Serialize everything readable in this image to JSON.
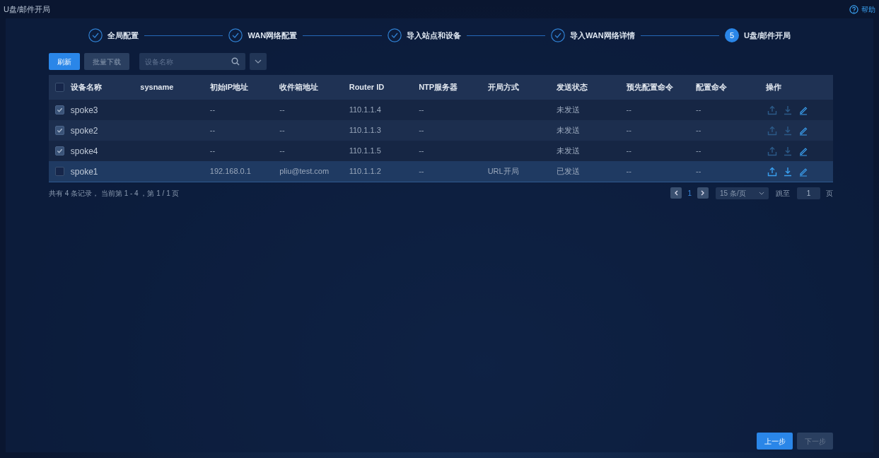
{
  "window": {
    "title": "U盘/邮件开局",
    "help": "帮助"
  },
  "steps": [
    {
      "label": "全局配置",
      "done": true
    },
    {
      "label": "WAN网络配置",
      "done": true
    },
    {
      "label": "导入站点和设备",
      "done": true
    },
    {
      "label": "导入WAN网络详情",
      "done": true
    },
    {
      "label": "U盘/邮件开局",
      "number": "5",
      "done": false
    }
  ],
  "toolbar": {
    "refresh": "刷新",
    "batch_download": "批量下载",
    "search": {
      "placeholder": "设备名称"
    }
  },
  "table": {
    "header_checked": false,
    "columns": [
      "设备名称",
      "sysname",
      "初始IP地址",
      "收件箱地址",
      "Router ID",
      "NTP服务器",
      "开局方式",
      "发送状态",
      "预先配置命令",
      "配置命令",
      "操作"
    ],
    "rows": [
      {
        "checked": true,
        "selected": false,
        "actions_enabled": false,
        "cells": [
          "spoke3",
          "",
          "--",
          "--",
          "110.1.1.4",
          "--",
          "",
          "未发送",
          "--",
          "--"
        ]
      },
      {
        "checked": true,
        "selected": false,
        "actions_enabled": false,
        "cells": [
          "spoke2",
          "",
          "--",
          "--",
          "110.1.1.3",
          "--",
          "",
          "未发送",
          "--",
          "--"
        ]
      },
      {
        "checked": true,
        "selected": false,
        "actions_enabled": false,
        "cells": [
          "spoke4",
          "",
          "--",
          "--",
          "110.1.1.5",
          "--",
          "",
          "未发送",
          "--",
          "--"
        ]
      },
      {
        "checked": false,
        "selected": true,
        "actions_enabled": true,
        "cells": [
          "spoke1",
          "",
          "192.168.0.1",
          "pliu@test.com",
          "110.1.1.2",
          "--",
          "URL开局",
          "已发送",
          "--",
          "--"
        ]
      }
    ]
  },
  "pagination": {
    "summary": "共有 4 条记录， 当前第 1 - 4 ，第 1 / 1 页",
    "page": "1",
    "page_size": "15 条/页",
    "goto_label": "跳至",
    "goto_value": "1",
    "page_unit": "页"
  },
  "footer": {
    "prev": "上一步",
    "next": "下一步",
    "next_disabled": true
  }
}
